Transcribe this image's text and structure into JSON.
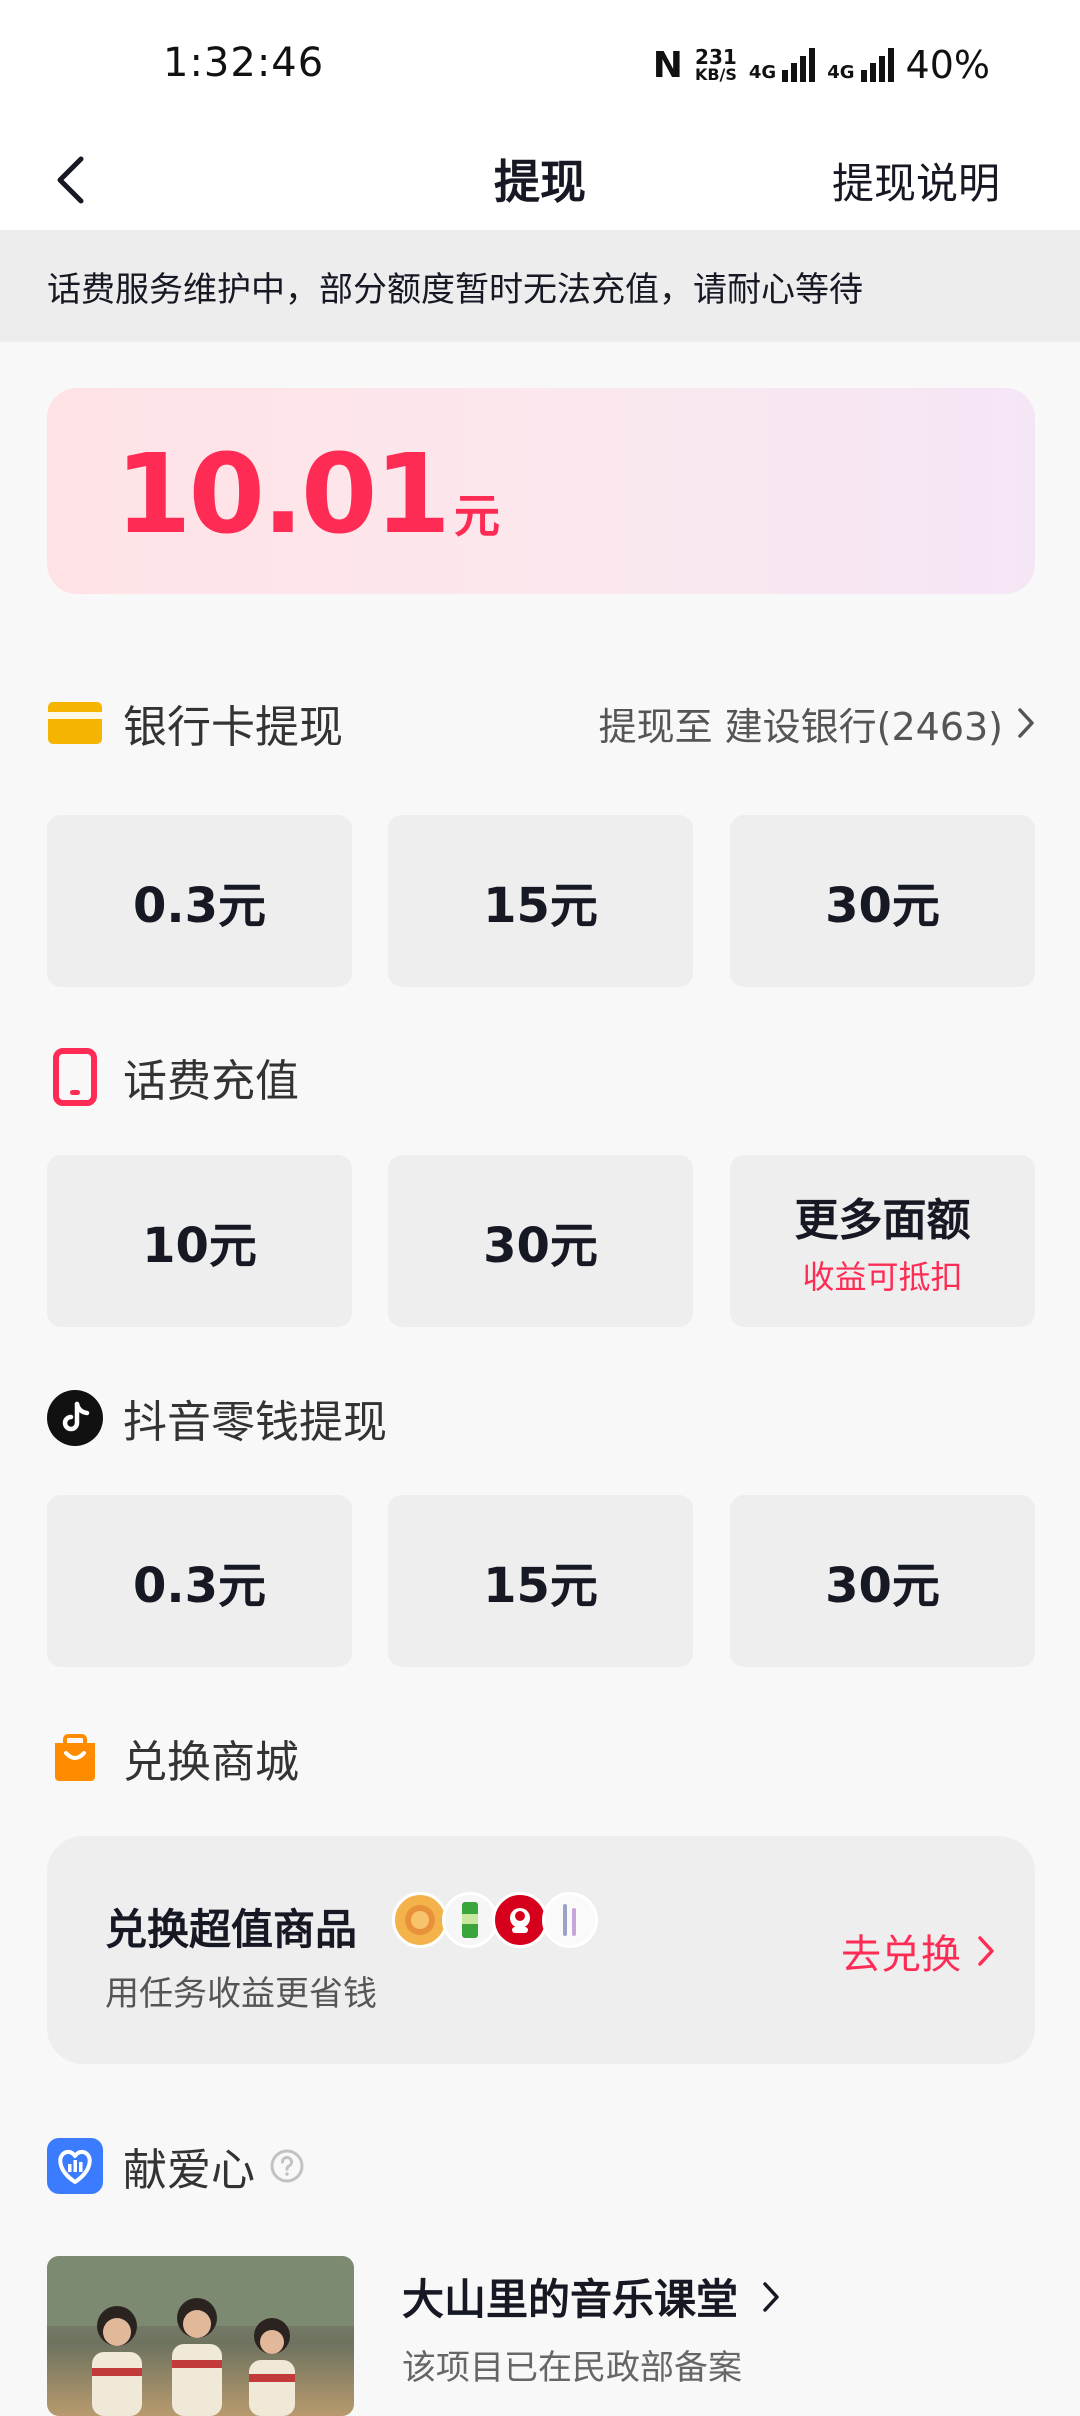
{
  "status_bar": {
    "time": "1:32:46",
    "nfc_label": "N",
    "speed_value": "231",
    "speed_unit": "KB/S",
    "network_label_1": "4G",
    "network_label_2": "4G",
    "battery": "40%"
  },
  "nav": {
    "title": "提现",
    "action": "提现说明"
  },
  "notice": "话费服务维护中，部分额度暂时无法充值，请耐心等待",
  "balance": {
    "value": "10.01",
    "unit": "元"
  },
  "sections": {
    "bank": {
      "title": "银行卡提现",
      "link": "提现至 建设银行(2463)",
      "options": [
        "0.3元",
        "15元",
        "30元"
      ]
    },
    "phone": {
      "title": "话费充值",
      "options": [
        "10元",
        "30元"
      ],
      "more_label": "更多面额",
      "more_sub": "收益可抵扣"
    },
    "douyin": {
      "title": "抖音零钱提现",
      "options": [
        "0.3元",
        "15元",
        "30元"
      ]
    },
    "mall": {
      "title": "兑换商城",
      "card_title": "兑换超值商品",
      "card_sub": "用任务收益更省钱",
      "button": "去兑换"
    },
    "charity": {
      "title": "献爱心",
      "project_title": "大山里的音乐课堂",
      "project_sub": "该项目已在民政部备案"
    }
  },
  "colors": {
    "accent": "#fe2c55",
    "bank_icon": "#f5b400",
    "mall_icon": "#ff8c00",
    "charity_icon": "#3b7cff"
  },
  "icons": [
    "back-arrow-icon",
    "bank-card-icon",
    "chevron-right-icon",
    "phone-icon",
    "tiktok-icon",
    "shopping-bag-icon",
    "charity-heart-icon",
    "help-circle-icon"
  ]
}
